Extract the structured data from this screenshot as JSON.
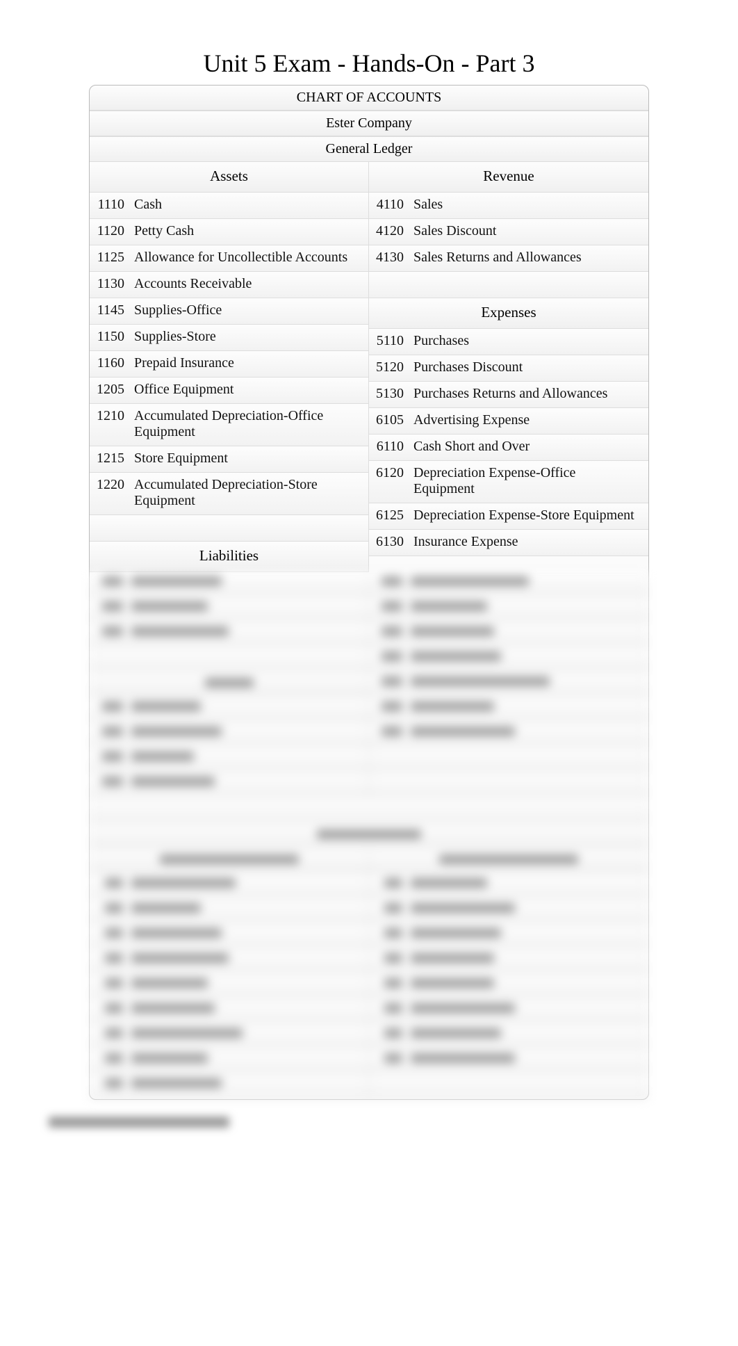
{
  "title": "Unit 5 Exam - Hands-On - Part 3",
  "header1": "CHART OF ACCOUNTS",
  "header2": "Ester Company",
  "header3": "General Ledger",
  "left_sections": [
    {
      "heading": "Assets",
      "rows": [
        {
          "code": "1110",
          "label": "Cash"
        },
        {
          "code": "1120",
          "label": "Petty Cash"
        },
        {
          "code": "1125",
          "label": "Allowance for Uncollectible Accounts"
        },
        {
          "code": "1130",
          "label": "Accounts Receivable"
        },
        {
          "code": "1145",
          "label": "Supplies-Office"
        },
        {
          "code": "1150",
          "label": "Supplies-Store"
        },
        {
          "code": "1160",
          "label": "Prepaid Insurance"
        },
        {
          "code": "1205",
          "label": "Office Equipment"
        },
        {
          "code": "1210",
          "label": "Accumulated Depreciation-Office Equipment"
        },
        {
          "code": "1215",
          "label": "Store Equipment"
        },
        {
          "code": "1220",
          "label": "Accumulated Depreciation-Store Equipment"
        }
      ]
    },
    {
      "heading": "Liabilities",
      "rows": []
    }
  ],
  "right_sections": [
    {
      "heading": "Revenue",
      "rows": [
        {
          "code": "4110",
          "label": "Sales"
        },
        {
          "code": "4120",
          "label": "Sales Discount"
        },
        {
          "code": "4130",
          "label": "Sales Returns and Allowances"
        }
      ]
    },
    {
      "heading": "Expenses",
      "rows": [
        {
          "code": "5110",
          "label": "Purchases"
        },
        {
          "code": "5120",
          "label": "Purchases Discount"
        },
        {
          "code": "5130",
          "label": "Purchases Returns and Allowances"
        },
        {
          "code": "6105",
          "label": "Advertising Expense"
        },
        {
          "code": "6110",
          "label": "Cash Short and Over"
        },
        {
          "code": "6120",
          "label": "Depreciation Expense-Office Equipment"
        },
        {
          "code": "6125",
          "label": "Depreciation Expense-Store Equipment"
        },
        {
          "code": "6130",
          "label": "Insurance Expense"
        }
      ]
    }
  ]
}
